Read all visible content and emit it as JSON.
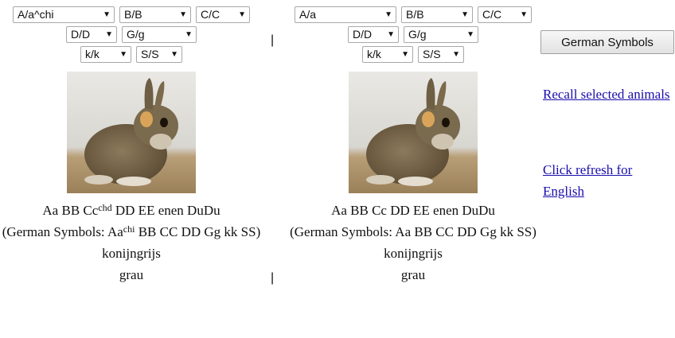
{
  "left_panel": {
    "selects_row1": [
      {
        "value": "A/a^chi",
        "name": "gene-a-select"
      },
      {
        "value": "B/B",
        "name": "gene-b-select"
      },
      {
        "value": "C/C",
        "name": "gene-c-select"
      }
    ],
    "selects_row2": [
      {
        "value": "D/D",
        "name": "gene-d-select"
      },
      {
        "value": "G/g",
        "name": "gene-g-select"
      }
    ],
    "selects_row3": [
      {
        "value": "k/k",
        "name": "gene-k-select"
      },
      {
        "value": "S/S",
        "name": "gene-s-select"
      }
    ],
    "genotype_pre": "Aa BB Cc",
    "genotype_sup": "chd",
    "genotype_post": " DD EE enen DuDu",
    "german_pre": "(German Symbols: Aa",
    "german_sup": "chi",
    "german_post": " BB CC DD Gg kk SS)",
    "breed": "konijngrijs",
    "color": "grau"
  },
  "right_panel": {
    "selects_row1": [
      {
        "value": "A/a",
        "name": "gene-a-select"
      },
      {
        "value": "B/B",
        "name": "gene-b-select"
      },
      {
        "value": "C/C",
        "name": "gene-c-select"
      }
    ],
    "selects_row2": [
      {
        "value": "D/D",
        "name": "gene-d-select"
      },
      {
        "value": "G/g",
        "name": "gene-g-select"
      }
    ],
    "selects_row3": [
      {
        "value": "k/k",
        "name": "gene-k-select"
      },
      {
        "value": "S/S",
        "name": "gene-s-select"
      }
    ],
    "genotype": "Aa BB Cc DD EE enen DuDu",
    "german": "(German Symbols: Aa BB CC DD Gg kk SS)",
    "breed": "konijngrijs",
    "color": "grau"
  },
  "divider_char": "|",
  "sidebar": {
    "german_symbols_button": "German Symbols",
    "recall_link": "Recall selected animals",
    "refresh_link": "Click refresh for English"
  },
  "icons": {
    "dropdown_arrow": "▼",
    "rabbit_image": "rabbit-photo"
  }
}
